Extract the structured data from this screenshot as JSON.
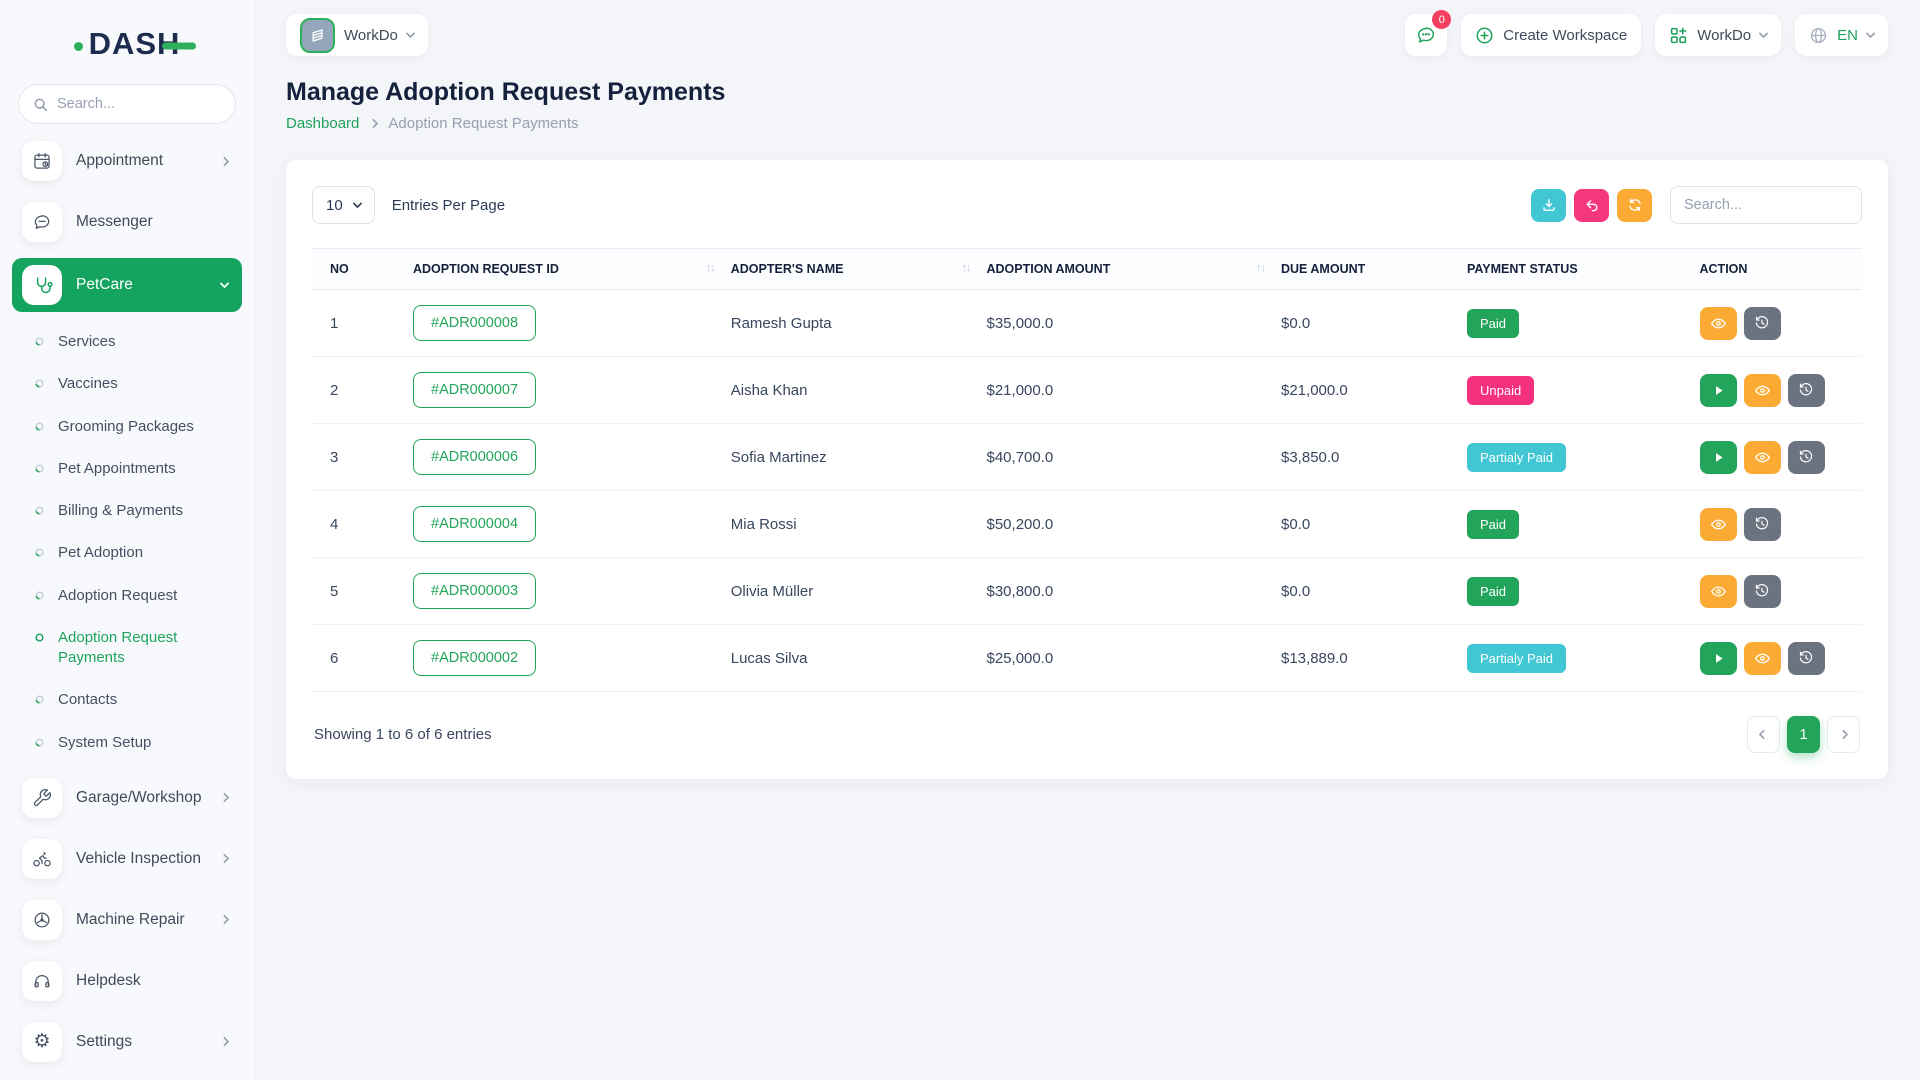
{
  "brand": {
    "name": "DASH"
  },
  "icons": {
    "sort": "↑↓",
    "gear": "⚙"
  },
  "topbar": {
    "workspace_name": "WorkDo",
    "chat_badge": "0",
    "create_workspace": "Create Workspace",
    "app_menu": "WorkDo",
    "language": "EN"
  },
  "sidebar": {
    "search_placeholder": "Search...",
    "appointment": "Appointment",
    "messenger": "Messenger",
    "petcare": "PetCare",
    "petcare_children": [
      "Services",
      "Vaccines",
      "Grooming Packages",
      "Pet Appointments",
      "Billing & Payments",
      "Pet Adoption",
      "Adoption Request",
      "Adoption Request Payments",
      "Contacts",
      "System Setup"
    ],
    "garage": "Garage/Workshop",
    "vehicle": "Vehicle Inspection",
    "machine": "Machine Repair",
    "helpdesk": "Helpdesk",
    "settings": "Settings"
  },
  "page": {
    "title": "Manage Adoption Request Payments",
    "breadcrumb_home": "Dashboard",
    "breadcrumb_current": "Adoption Request Payments"
  },
  "controls": {
    "entries_value": "10",
    "entries_label": "Entries Per Page",
    "search_placeholder": "Search..."
  },
  "table": {
    "headers": {
      "no": "NO",
      "id": "ADOPTION REQUEST ID",
      "name": "ADOPTER'S NAME",
      "amount": "ADOPTION AMOUNT",
      "due": "DUE AMOUNT",
      "status": "PAYMENT STATUS",
      "action": "ACTION"
    },
    "rows": [
      {
        "no": "1",
        "id": "#ADR000008",
        "name": "Ramesh Gupta",
        "amount": "$35,000.0",
        "due": "$0.0",
        "status": "Paid"
      },
      {
        "no": "2",
        "id": "#ADR000007",
        "name": "Aisha Khan",
        "amount": "$21,000.0",
        "due": "$21,000.0",
        "status": "Unpaid"
      },
      {
        "no": "3",
        "id": "#ADR000006",
        "name": "Sofia Martinez",
        "amount": "$40,700.0",
        "due": "$3,850.0",
        "status": "Partialy Paid"
      },
      {
        "no": "4",
        "id": "#ADR000004",
        "name": "Mia Rossi",
        "amount": "$50,200.0",
        "due": "$0.0",
        "status": "Paid"
      },
      {
        "no": "5",
        "id": "#ADR000003",
        "name": "Olivia Müller",
        "amount": "$30,800.0",
        "due": "$0.0",
        "status": "Paid"
      },
      {
        "no": "6",
        "id": "#ADR000002",
        "name": "Lucas Silva",
        "amount": "$25,000.0",
        "due": "$13,889.0",
        "status": "Partialy Paid"
      }
    ],
    "summary": "Showing 1 to 6 of 6 entries",
    "page_number": "1"
  },
  "colors": {
    "green": "#22a55b",
    "cyan": "#41c6d4",
    "pink": "#f5317f",
    "orange": "#fbab33",
    "slate": "#6b7280"
  }
}
